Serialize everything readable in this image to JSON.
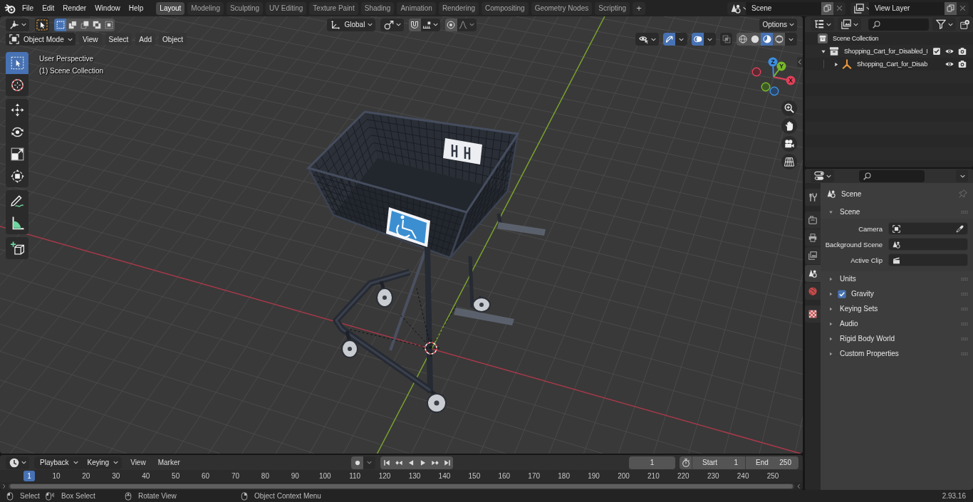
{
  "top_bar": {
    "menus": [
      "File",
      "Edit",
      "Render",
      "Window",
      "Help"
    ],
    "workspaces": [
      {
        "label": "Layout",
        "selected": true
      },
      {
        "label": "Modeling",
        "selected": false
      },
      {
        "label": "Sculpting",
        "selected": false
      },
      {
        "label": "UV Editing",
        "selected": false
      },
      {
        "label": "Texture Paint",
        "selected": false
      },
      {
        "label": "Shading",
        "selected": false
      },
      {
        "label": "Animation",
        "selected": false
      },
      {
        "label": "Rendering",
        "selected": false
      },
      {
        "label": "Compositing",
        "selected": false
      },
      {
        "label": "Geometry Nodes",
        "selected": false
      },
      {
        "label": "Scripting",
        "selected": false
      }
    ],
    "add_workspace": "+",
    "scene": "Scene",
    "view_layer": "View Layer"
  },
  "viewport": {
    "select_modes": [
      {
        "selected": true
      },
      {
        "selected": false
      },
      {
        "selected": false
      },
      {
        "selected": false
      },
      {
        "selected": false
      }
    ],
    "orientation": "Global",
    "snap": false,
    "proportional_editing": false,
    "options": "Options",
    "mode": "Object Mode",
    "menus": [
      "View",
      "Select",
      "Add",
      "Object"
    ],
    "gizmos": true,
    "overlays": true,
    "xray": false,
    "shading": [
      {
        "selected": false
      },
      {
        "selected": false
      },
      {
        "selected": true
      },
      {
        "selected": false
      }
    ],
    "tools": [
      {
        "selected": true
      },
      {
        "selected": false
      },
      {
        "selected": false
      },
      {
        "selected": false
      },
      {
        "selected": false
      },
      {
        "selected": false
      },
      {
        "selected": false
      },
      {
        "selected": false
      },
      {
        "selected": false
      }
    ],
    "info": [
      "User Perspective",
      "(1) Scene Collection"
    ],
    "gizmo_axes": [
      "X",
      "Y",
      "Z"
    ]
  },
  "outliner": {
    "tree": [
      {
        "label": "Scene Collection",
        "kind": "scene",
        "children": [
          {
            "label": "Shopping_Cart_for_Disabled_I",
            "kind": "collection",
            "expanded": true,
            "checked": true,
            "children": [
              {
                "label": "Shopping_Cart_for_Disab",
                "kind": "empty",
                "expanded": false
              }
            ]
          }
        ]
      }
    ]
  },
  "properties": {
    "tabs": [
      {
        "selected": false
      },
      {
        "selected": false
      },
      {
        "selected": false
      },
      {
        "selected": false
      },
      {
        "selected": true
      },
      {
        "selected": false
      },
      {
        "selected": false
      }
    ],
    "context": "Scene",
    "panels": [
      {
        "title": "Scene",
        "expanded": true,
        "fields": [
          {
            "label": "Camera",
            "kind": "camera"
          },
          {
            "label": "Background Scene",
            "kind": "scene"
          },
          {
            "label": "Active Clip",
            "kind": "clip"
          }
        ]
      },
      {
        "title": "Units",
        "expanded": false
      },
      {
        "title": "Gravity",
        "expanded": false,
        "checked": true
      },
      {
        "title": "Keying Sets",
        "expanded": false
      },
      {
        "title": "Audio",
        "expanded": false
      },
      {
        "title": "Rigid Body World",
        "expanded": false
      },
      {
        "title": "Custom Properties",
        "expanded": false
      }
    ]
  },
  "timeline": {
    "editor_menus": [
      {
        "label": "Playback",
        "dropdown": true
      },
      {
        "label": "Keying",
        "dropdown": true
      },
      {
        "label": "View",
        "dropdown": false
      },
      {
        "label": "Marker",
        "dropdown": false
      }
    ],
    "current_frame": "1",
    "start": {
      "label": "Start",
      "value": "1"
    },
    "end": {
      "label": "End",
      "value": "250"
    },
    "frames": [
      {
        "label": "1",
        "selected": true
      },
      {
        "label": "10",
        "selected": false
      },
      {
        "label": "20",
        "selected": false
      },
      {
        "label": "30",
        "selected": false
      },
      {
        "label": "40",
        "selected": false
      },
      {
        "label": "50",
        "selected": false
      },
      {
        "label": "60",
        "selected": false
      },
      {
        "label": "70",
        "selected": false
      },
      {
        "label": "80",
        "selected": false
      },
      {
        "label": "90",
        "selected": false
      },
      {
        "label": "100",
        "selected": false
      },
      {
        "label": "110",
        "selected": false
      },
      {
        "label": "120",
        "selected": false
      },
      {
        "label": "130",
        "selected": false
      },
      {
        "label": "140",
        "selected": false
      },
      {
        "label": "150",
        "selected": false
      },
      {
        "label": "160",
        "selected": false
      },
      {
        "label": "170",
        "selected": false
      },
      {
        "label": "180",
        "selected": false
      },
      {
        "label": "190",
        "selected": false
      },
      {
        "label": "200",
        "selected": false
      },
      {
        "label": "210",
        "selected": false
      },
      {
        "label": "220",
        "selected": false
      },
      {
        "label": "230",
        "selected": false
      },
      {
        "label": "240",
        "selected": false
      },
      {
        "label": "250",
        "selected": false
      }
    ]
  },
  "status_bar": {
    "hints": [
      {
        "label": "Select",
        "kind": "left"
      },
      {
        "label": "Box Select",
        "kind": "drag"
      },
      {
        "label": "Rotate View",
        "kind": "middle"
      },
      {
        "label": "Object Context Menu",
        "kind": "right"
      }
    ],
    "version": "2.93.16"
  }
}
